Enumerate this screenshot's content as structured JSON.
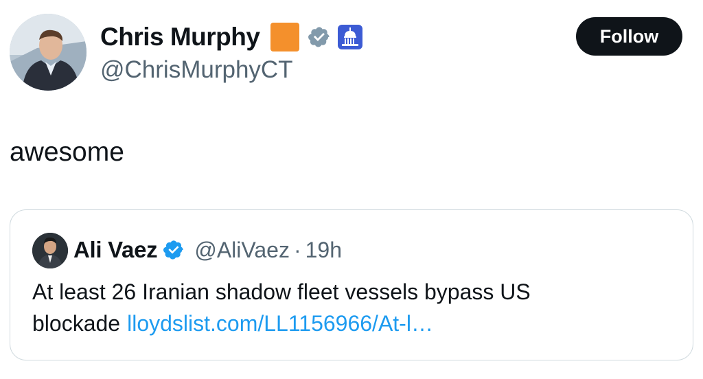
{
  "author": {
    "display_name": "Chris Murphy",
    "handle": "@ChrisMurphyCT",
    "badges": [
      "orange-square-icon",
      "verified-gray-icon",
      "government-capitol-icon"
    ],
    "colors": {
      "orange_square": "#f4902c",
      "verified_gray": "#829aab",
      "gov_badge_bg": "#3c5bd4"
    }
  },
  "follow_button": {
    "label": "Follow",
    "bg": "#0f1419",
    "fg": "#ffffff"
  },
  "tweet": {
    "text": "awesome"
  },
  "quoted_tweet": {
    "display_name": "Ali Vaez",
    "verified_icon": "verified-blue-icon",
    "verified_color": "#1d9bf0",
    "handle": "@AliVaez",
    "separator": "·",
    "time": "19h",
    "text": "At least 26 Iranian shadow fleet vessels bypass US blockade",
    "link_text": "lloydslist.com/LL1156966/At-l…",
    "link_color": "#1d9bf0"
  }
}
